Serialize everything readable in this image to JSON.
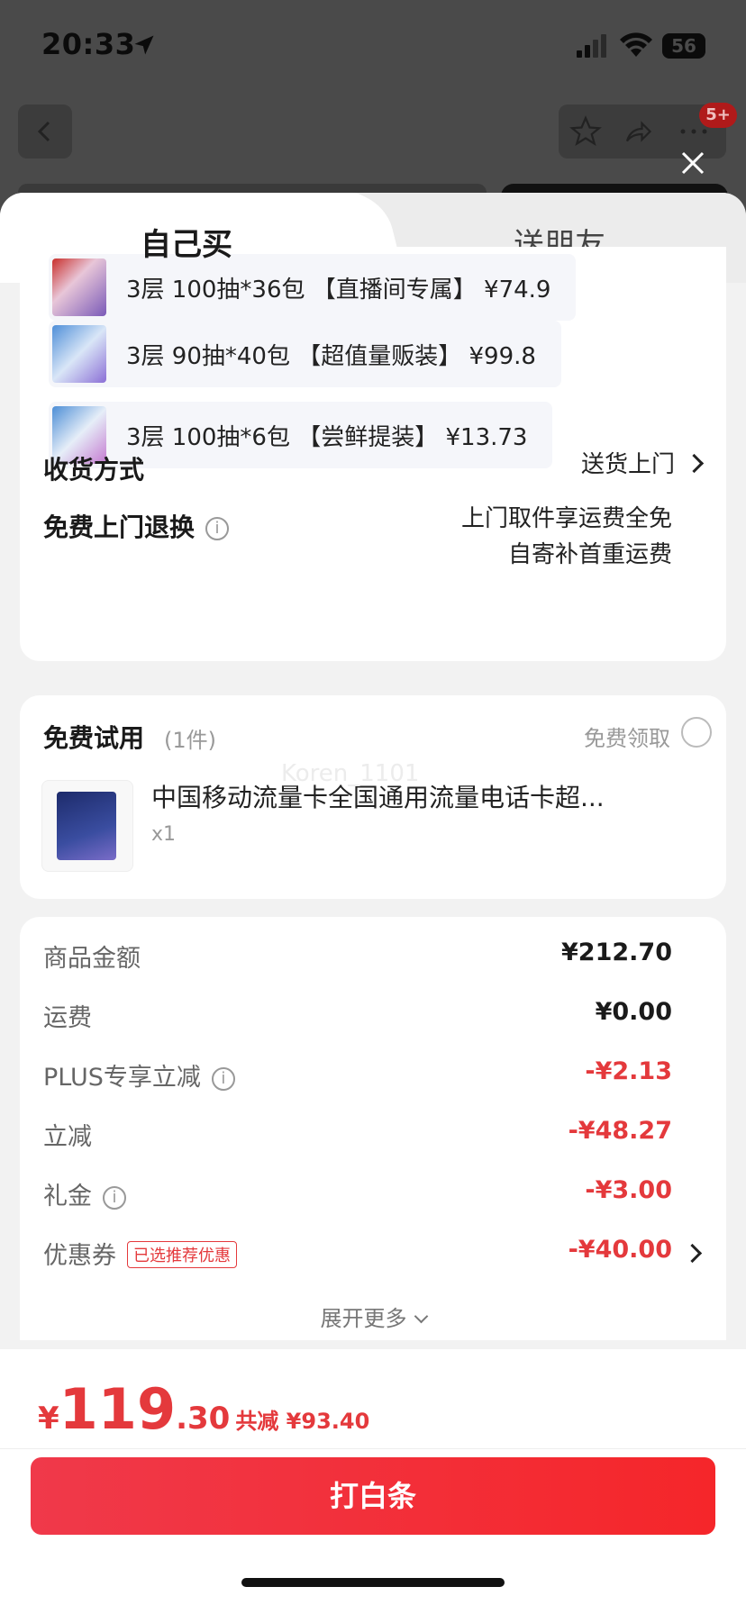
{
  "status": {
    "time": "20:33",
    "battery": "56"
  },
  "header": {
    "badge": "5+"
  },
  "tabs": {
    "buy": "自己买",
    "gift": "送朋友"
  },
  "skus": [
    {
      "text": "3层 100抽*36包 【直播间专属】 ¥74.9"
    },
    {
      "text": "3层 90抽*40包 【超值量贩装】 ¥99.8"
    },
    {
      "text": "3层 100抽*6包 【尝鲜提装】 ¥13.73"
    }
  ],
  "delivery": {
    "label": "收货方式",
    "value": "送货上门"
  },
  "returns": {
    "label": "免费上门退换",
    "line1": "上门取件享运费全免",
    "line2": "自寄补首重运费",
    "info_icon": "i"
  },
  "trial": {
    "title": "免费试用",
    "count": "(1件)",
    "claim": "免费领取",
    "item_name": "中国移动流量卡全国通用流量电话卡超...",
    "qty": "x1",
    "watermark": "Koren_1101"
  },
  "fees": {
    "goods_label": "商品金额",
    "goods_value": "¥212.70",
    "ship_label": "运费",
    "ship_value": "¥0.00",
    "plus_label": "PLUS专享立减",
    "plus_value": "-¥2.13",
    "cut_label": "立减",
    "cut_value": "-¥48.27",
    "gift_label": "礼金",
    "gift_value": "-¥3.00",
    "coupon_label": "优惠券",
    "coupon_tag": "已选推荐优惠",
    "coupon_value": "-¥40.00",
    "more": "展开更多",
    "info_icon": "i"
  },
  "footer": {
    "yen": "¥",
    "price_int": "119",
    "price_dec": ".30",
    "saved": "共减 ¥93.40",
    "pay_button": "打白条"
  },
  "colors": {
    "accent_red": "#e4393c",
    "button_red": "#f5262a"
  }
}
